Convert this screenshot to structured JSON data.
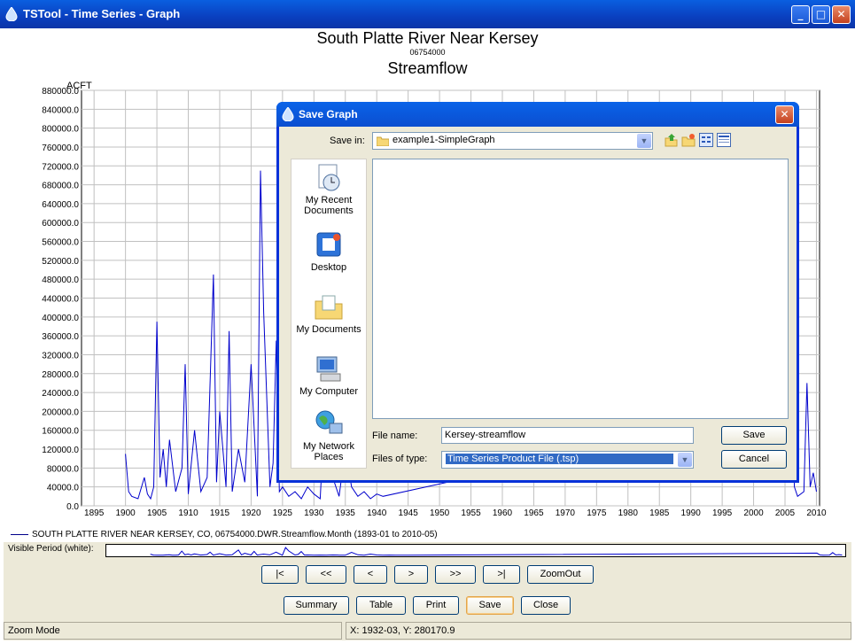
{
  "window": {
    "title": "TSTool - Time Series - Graph",
    "minimize": "_",
    "maximize": "□",
    "close": "✕"
  },
  "graph": {
    "title": "South Platte River Near Kersey",
    "subtitle": "06754000",
    "subtitle2": "Streamflow",
    "y_unit": "ACFT",
    "legend": "SOUTH PLATTE RIVER NEAR KERSEY, CO, 06754000.DWR.Streamflow.Month (1893-01 to 2010-05)",
    "visible_period_label": "Visible Period (white):"
  },
  "chart_data": {
    "type": "line",
    "ylabel": "ACFT",
    "ylim": [
      0,
      880000
    ],
    "xlim": [
      1893,
      2010.5
    ],
    "y_ticks": [
      "0.0",
      "40000.0",
      "80000.0",
      "120000.0",
      "160000.0",
      "200000.0",
      "240000.0",
      "280000.0",
      "320000.0",
      "360000.0",
      "400000.0",
      "440000.0",
      "480000.0",
      "520000.0",
      "560000.0",
      "600000.0",
      "640000.0",
      "680000.0",
      "720000.0",
      "760000.0",
      "800000.0",
      "840000.0",
      "880000.0"
    ],
    "x_ticks": [
      "1895",
      "1900",
      "1905",
      "1910",
      "1915",
      "1920",
      "1925",
      "1930",
      "1935",
      "1940",
      "1945",
      "1950",
      "1955",
      "1960",
      "1965",
      "1970",
      "1975",
      "1980",
      "1985",
      "1990",
      "1995",
      "2000",
      "2005",
      "2010"
    ],
    "series": [
      {
        "name": "SOUTH PLATTE RIVER NEAR KERSEY, CO, 06754000.DWR.Streamflow.Month (1893-01 to 2010-05)",
        "color": "#0000cc",
        "x": [
          1900.0,
          1900.5,
          1901.0,
          1902.0,
          1903.0,
          1903.5,
          1904.0,
          1904.5,
          1905.0,
          1905.5,
          1906.0,
          1906.5,
          1907.0,
          1908.0,
          1909.0,
          1909.5,
          1910.0,
          1911.0,
          1912.0,
          1913.0,
          1914.0,
          1914.5,
          1915.0,
          1916.0,
          1916.5,
          1917.0,
          1918.0,
          1919.0,
          1920.0,
          1921.0,
          1921.5,
          1922.0,
          1923.0,
          1923.5,
          1924.0,
          1924.5,
          1925.0,
          1926.0,
          1927.0,
          1928.0,
          1929.0,
          1930.0,
          1931.0,
          1932.0,
          1933.0,
          1934.0,
          1935.0,
          1936.0,
          1937.0,
          1938.0,
          1939.0,
          1940.0,
          1941.0,
          2006.0,
          2006.5,
          2007.0,
          2008.0,
          2008.5,
          2009.0,
          2009.5,
          2010.0
        ],
        "y": [
          110000,
          30000,
          20000,
          15000,
          60000,
          25000,
          15000,
          40000,
          390000,
          60000,
          120000,
          40000,
          140000,
          30000,
          80000,
          300000,
          25000,
          160000,
          30000,
          60000,
          490000,
          50000,
          200000,
          40000,
          370000,
          30000,
          120000,
          50000,
          300000,
          20000,
          710000,
          410000,
          40000,
          90000,
          350000,
          30000,
          40000,
          20000,
          30000,
          15000,
          40000,
          25000,
          15000,
          280000,
          60000,
          20000,
          120000,
          40000,
          20000,
          30000,
          15000,
          25000,
          20000,
          210000,
          40000,
          20000,
          30000,
          260000,
          40000,
          70000,
          30000
        ]
      }
    ]
  },
  "controls": {
    "nav": [
      "|<",
      "<<",
      "<",
      ">",
      ">>",
      ">|",
      "ZoomOut"
    ],
    "actions": [
      "Summary",
      "Table",
      "Print",
      "Save",
      "Close"
    ]
  },
  "status": {
    "mode": "Zoom Mode",
    "coords": "X:  1932-03,  Y:  280170.9"
  },
  "dialog": {
    "title": "Save Graph",
    "save_in_label": "Save in:",
    "save_in_value": "example1-SimpleGraph",
    "places": [
      "My Recent Documents",
      "Desktop",
      "My Documents",
      "My Computer",
      "My Network Places"
    ],
    "file_name_label": "File name:",
    "file_name_value": "Kersey-streamflow",
    "files_of_type_label": "Files of type:",
    "files_of_type_value": "Time Series Product File (.tsp)",
    "save_button": "Save",
    "cancel_button": "Cancel"
  }
}
